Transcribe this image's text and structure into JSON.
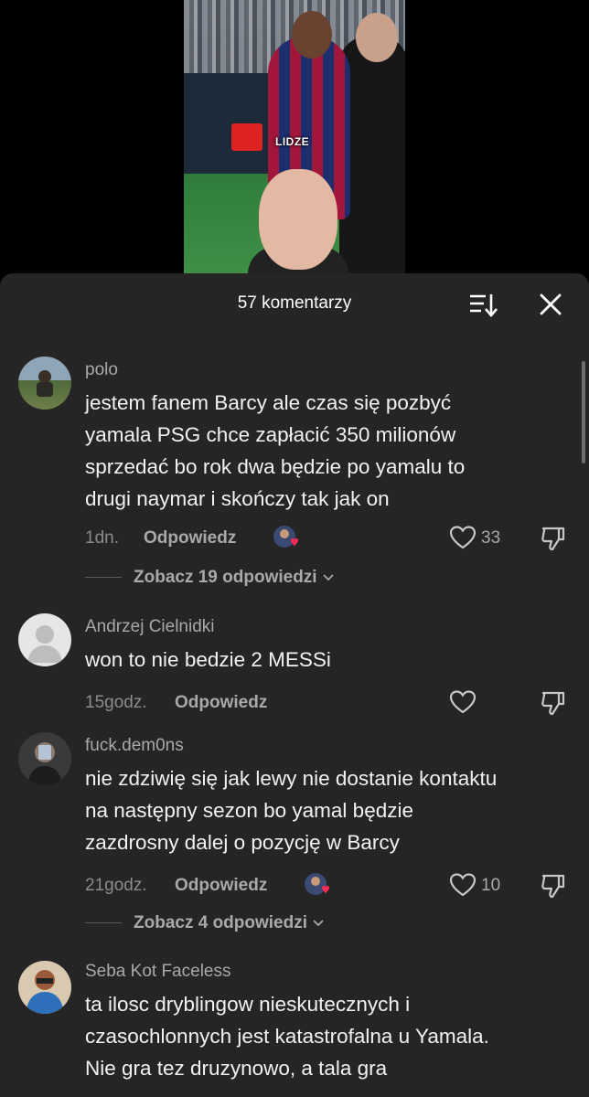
{
  "video": {
    "caption": "LIDZE"
  },
  "sheet": {
    "title": "57 komentarzy"
  },
  "comments": [
    {
      "username": "polo",
      "lines": [
        "jestem fanem Barcy ale czas się pozbyć",
        "yamala PSG chce zapłacić 350 milionów",
        "sprzedać bo rok dwa będzie po yamalu to",
        "drugi naymar i skończy tak jak on"
      ],
      "time": "1dn.",
      "reply": "Odpowiedz",
      "likes": "33",
      "view_replies": "Zobacz 19 odpowiedzi"
    },
    {
      "username": "Andrzej Cielnidki",
      "lines": [
        "won to nie bedzie 2 MESSi"
      ],
      "time": "15godz.",
      "reply": "Odpowiedz"
    },
    {
      "username": "fuck.dem0ns",
      "lines": [
        "nie zdziwię się jak lewy nie dostanie kontaktu",
        "na następny sezon bo yamal będzie",
        "zazdrosny dalej o pozycję w Barcy"
      ],
      "time": "21godz.",
      "reply": "Odpowiedz",
      "likes": "10",
      "view_replies": "Zobacz 4 odpowiedzi"
    },
    {
      "username": "Seba Kot Faceless",
      "lines": [
        "ta ilosc dryblingow nieskutecznych i",
        "czasochlonnych jest katastrofalna u Yamala.",
        "Nie gra tez druzynowo, a tala gra"
      ]
    }
  ],
  "colors": {
    "sheet_bg": "#252525",
    "liked_heart": "#fe2c55",
    "text_secondary": "#a9a9a9"
  },
  "icons": [
    "sort-icon",
    "close-icon",
    "heart-icon",
    "dislike-icon",
    "chevron-down-icon",
    "default-avatar-icon"
  ]
}
